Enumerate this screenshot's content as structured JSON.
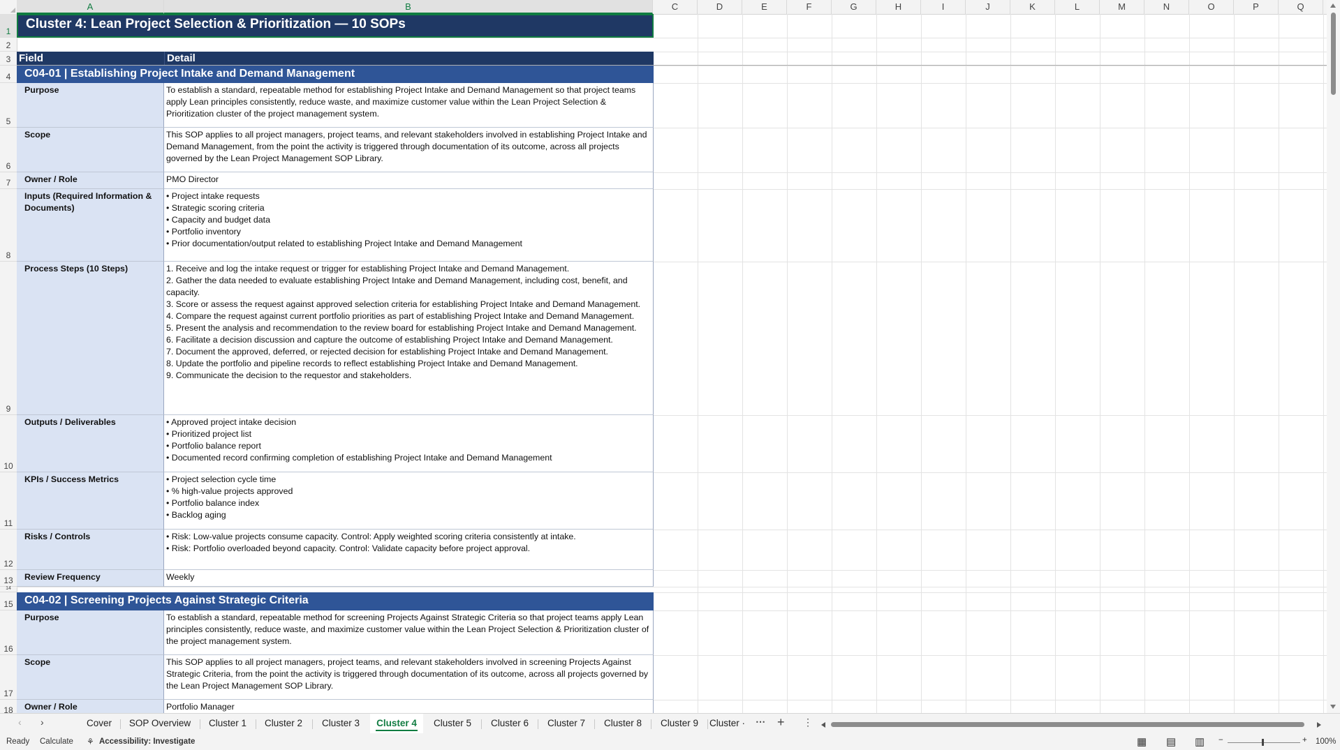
{
  "columns": [
    "A",
    "B",
    "C",
    "D",
    "E",
    "F",
    "G",
    "H",
    "I",
    "J",
    "K",
    "L",
    "M",
    "N",
    "O",
    "P",
    "Q"
  ],
  "rows": [
    "1",
    "2",
    "3",
    "4",
    "5",
    "6",
    "7",
    "8",
    "9",
    "10",
    "11",
    "12",
    "13",
    "14",
    "15",
    "16",
    "17",
    "18"
  ],
  "title": "Cluster 4: Lean Project Selection & Prioritization  —  10 SOPs",
  "table_header": {
    "field": "Field",
    "detail": "Detail"
  },
  "sop1": {
    "header": "C04-01  |  Establishing Project Intake and Demand Management",
    "rows": [
      {
        "field": "Purpose",
        "detail": "To establish a standard, repeatable method for establishing Project Intake and Demand Management so that project teams apply Lean principles consistently, reduce waste, and maximize customer value within the Lean Project Selection & Prioritization cluster of the project management system."
      },
      {
        "field": "Scope",
        "detail": "This SOP applies to all project managers, project teams, and relevant stakeholders involved in establishing Project Intake and Demand Management, from the point the activity is triggered through documentation of its outcome, across all projects governed by the Lean Project Management SOP Library."
      },
      {
        "field": "Owner / Role",
        "detail": "PMO Director"
      },
      {
        "field": "Inputs (Required Information & Documents)",
        "detail": "• Project intake requests\n• Strategic scoring criteria\n• Capacity and budget data\n• Portfolio inventory\n• Prior documentation/output related to establishing Project Intake and Demand Management"
      },
      {
        "field": "Process Steps (10 Steps)",
        "detail": "1. Receive and log the intake request or trigger for establishing Project Intake and Demand Management.\n2. Gather the data needed to evaluate establishing Project Intake and Demand Management, including cost, benefit, and capacity.\n3. Score or assess the request against approved selection criteria for establishing Project Intake and Demand Management.\n4. Compare the request against current portfolio priorities as part of establishing Project Intake and Demand Management.\n5. Present the analysis and recommendation to the review board for establishing Project Intake and Demand Management.\n6. Facilitate a decision discussion and capture the outcome of establishing Project Intake and Demand Management.\n7. Document the approved, deferred, or rejected decision for establishing Project Intake and Demand Management.\n8. Update the portfolio and pipeline records to reflect establishing Project Intake and Demand Management.\n9. Communicate the decision to the requestor and stakeholders."
      },
      {
        "field": "Outputs / Deliverables",
        "detail": "• Approved project intake decision\n• Prioritized project list\n• Portfolio balance report\n• Documented record confirming completion of establishing Project Intake and Demand Management"
      },
      {
        "field": "KPIs / Success Metrics",
        "detail": "• Project selection cycle time\n• % high-value projects approved\n• Portfolio balance index\n• Backlog aging"
      },
      {
        "field": "Risks / Controls",
        "detail": "• Risk: Low-value projects consume capacity. Control: Apply weighted scoring criteria consistently at intake.\n• Risk: Portfolio overloaded beyond capacity. Control: Validate capacity before project approval."
      },
      {
        "field": "Review Frequency",
        "detail": "Weekly"
      }
    ]
  },
  "sop2": {
    "header": "C04-02  |  Screening Projects Against Strategic Criteria",
    "rows": [
      {
        "field": "Purpose",
        "detail": "To establish a standard, repeatable method for screening Projects Against Strategic Criteria so that project teams apply Lean principles consistently, reduce waste, and maximize customer value within the Lean Project Selection & Prioritization cluster of the project management system."
      },
      {
        "field": "Scope",
        "detail": "This SOP applies to all project managers, project teams, and relevant stakeholders involved in screening Projects Against Strategic Criteria, from the point the activity is triggered through documentation of its outcome, across all projects governed by the Lean Project Management SOP Library."
      },
      {
        "field": "Owner / Role",
        "detail": "Portfolio Manager"
      }
    ]
  },
  "tabs": [
    "Cover",
    "SOP Overview",
    "Cluster 1",
    "Cluster 2",
    "Cluster 3",
    "Cluster 4",
    "Cluster 5",
    "Cluster 6",
    "Cluster 7",
    "Cluster 8",
    "Cluster 9",
    "Cluster ·"
  ],
  "active_tab": "Cluster 4",
  "status": {
    "ready": "Ready",
    "calculate": "Calculate",
    "accessibility": "Accessibility: Investigate",
    "zoom": "100%"
  },
  "colors": {
    "title_bg": "#1f3864",
    "sop_header_bg": "#2f5597",
    "field_bg": "#dae3f3",
    "accent": "#107c41"
  }
}
